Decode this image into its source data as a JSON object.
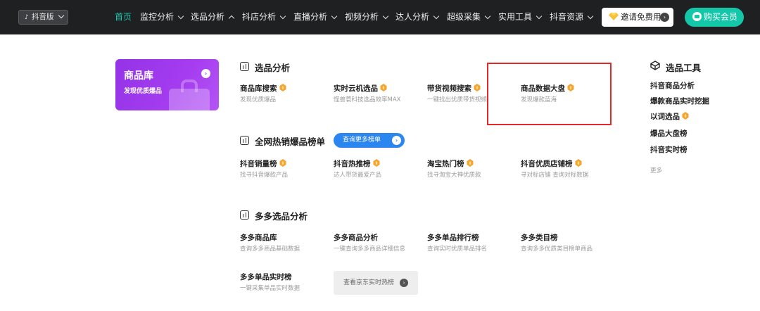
{
  "colors": {
    "accent": "#1fc8b3",
    "topbar": "#1f2021",
    "highlight": "#e32a2a",
    "hot": "#f4a531"
  },
  "topbar": {
    "platform_label": "抖音版",
    "nav": [
      {
        "label": "首页",
        "active": true
      },
      {
        "label": "监控分析"
      },
      {
        "label": "选品分析"
      },
      {
        "label": "抖店分析"
      },
      {
        "label": "直播分析"
      },
      {
        "label": "视频分析"
      },
      {
        "label": "达人分析"
      },
      {
        "label": "超级采集"
      },
      {
        "label": "实用工具"
      },
      {
        "label": "抖音资源"
      }
    ],
    "invite_label": "邀请免费用",
    "buy_label": "购买会员"
  },
  "card": {
    "title": "商品库",
    "subtitle": "发现优质爆品"
  },
  "sections": {
    "select": {
      "title": "选品分析",
      "items": [
        {
          "name": "商品库搜索",
          "desc": "发现优质爆品",
          "hot": true
        },
        {
          "name": "实时云机选品",
          "desc": "怪兽蓑科技选品效率MAX",
          "hot": true
        },
        {
          "name": "带货视频搜索",
          "desc": "一键找出优质带货视频",
          "hot": true
        },
        {
          "name": "商品数据大盘",
          "desc": "发现爆款蓝海",
          "hot": true
        }
      ]
    },
    "hotlist": {
      "title": "全网热销爆品榜单",
      "more_label": "查询更多榜单",
      "items": [
        {
          "name": "抖音销量榜",
          "desc": "找寻抖音爆款产品",
          "hot": true
        },
        {
          "name": "抖音热推榜",
          "desc": "达人带货最爱产品",
          "hot": true
        },
        {
          "name": "淘宝热门榜",
          "desc": "找寻淘宝大神优质款",
          "hot": true
        },
        {
          "name": "抖音优质店铺榜",
          "desc": "寻对标店铺 查询对标数据",
          "hot": true
        }
      ]
    },
    "duoduo": {
      "title": "多多选品分析",
      "items": [
        {
          "name": "多多商品库",
          "desc": "查询多多商品基础数据"
        },
        {
          "name": "多多商品分析",
          "desc": "一键查询多多商品详细信息"
        },
        {
          "name": "多多单品排行榜",
          "desc": "查询实时优质单品排名"
        },
        {
          "name": "多多类目榜",
          "desc": "查询多多优质类目榜单商品"
        },
        {
          "name": "多多单品实时榜",
          "desc": "一键采集单品实时数据"
        }
      ],
      "jd_label": "查看京东实时热榜"
    }
  },
  "tools": {
    "title": "选品工具",
    "items": [
      {
        "label": "抖音商品分析"
      },
      {
        "label": "爆款商品实时挖掘"
      },
      {
        "label": "以词选品",
        "hot": true
      },
      {
        "label": "爆品大盘榜"
      },
      {
        "label": "抖音实时榜"
      }
    ],
    "more_label": "更多"
  }
}
